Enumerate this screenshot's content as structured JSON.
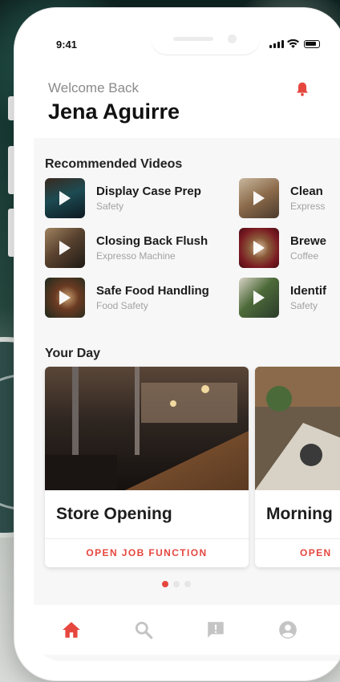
{
  "status": {
    "time": "9:41"
  },
  "header": {
    "welcome": "Welcome Back",
    "name": "Jena Aguirre"
  },
  "recommended": {
    "title": "Recommended Videos",
    "videos": [
      {
        "title": "Display Case Prep",
        "category": "Safety"
      },
      {
        "title": "Clean",
        "category": "Express"
      },
      {
        "title": "Closing Back Flush",
        "category": "Expresso Machine"
      },
      {
        "title": "Brewe",
        "category": "Coffee"
      },
      {
        "title": "Safe Food Handling",
        "category": "Food Safety"
      },
      {
        "title": "Identif",
        "category": "Safety"
      }
    ]
  },
  "your_day": {
    "title": "Your Day",
    "cards": [
      {
        "title": "Store Opening",
        "action": "OPEN JOB FUNCTION"
      },
      {
        "title": "Morning",
        "action": "OPEN"
      }
    ],
    "page_count": 3,
    "active_page": 1
  },
  "nav": {
    "items": [
      {
        "icon": "home-icon",
        "active": true
      },
      {
        "icon": "search-icon",
        "active": false
      },
      {
        "icon": "feedback-icon",
        "active": false
      },
      {
        "icon": "profile-icon",
        "active": false
      }
    ]
  },
  "colors": {
    "accent": "#e5473f",
    "inactive_icon": "#c4c4c4"
  }
}
